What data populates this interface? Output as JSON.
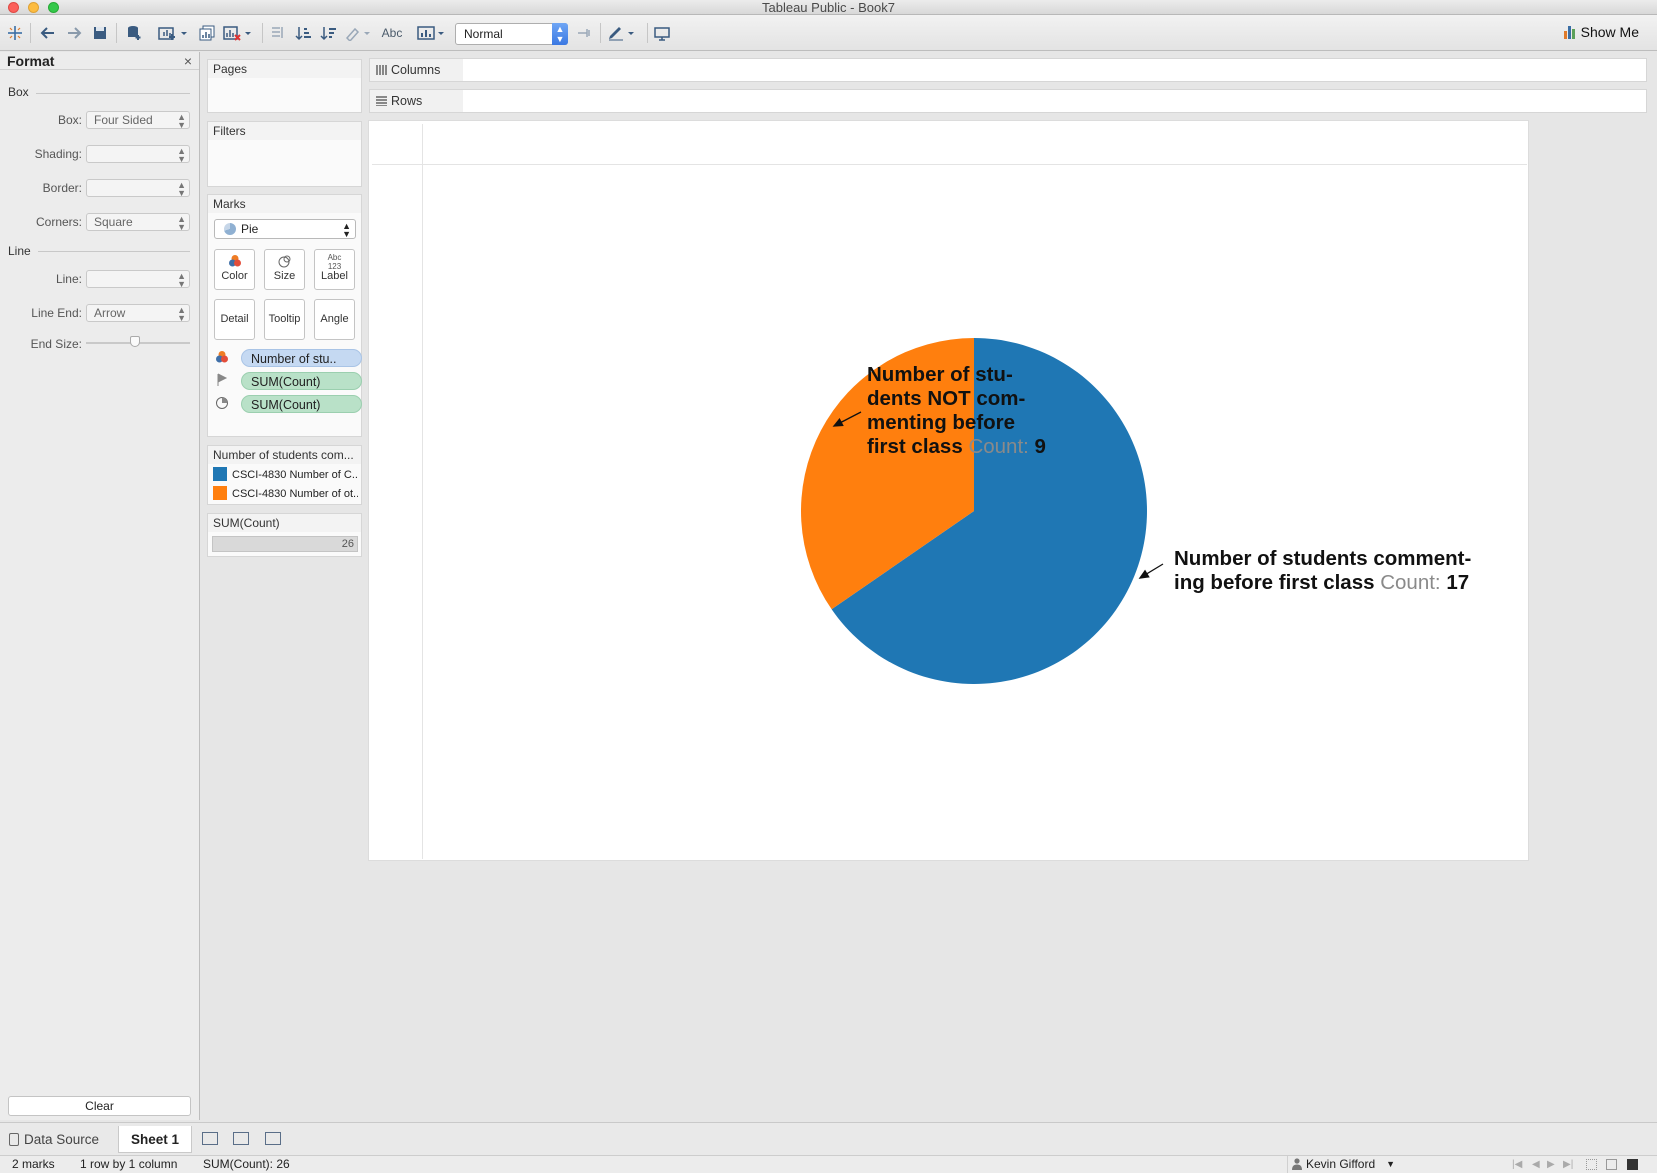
{
  "window": {
    "title": "Tableau Public - Book7"
  },
  "toolbar": {
    "fit_value": "Normal",
    "show_me_label": "Show Me",
    "abc_label": "Abc"
  },
  "format_pane": {
    "title": "Format",
    "close_glyph": "×",
    "box_section": "Box",
    "line_section": "Line",
    "rows": [
      {
        "label": "Box:",
        "value": "Four Sided"
      },
      {
        "label": "Shading:",
        "value": ""
      },
      {
        "label": "Border:",
        "value": ""
      },
      {
        "label": "Corners:",
        "value": "Square"
      },
      {
        "label": "Line:",
        "value": ""
      },
      {
        "label": "Line End:",
        "value": "Arrow"
      },
      {
        "label": "End Size:",
        "value": ""
      }
    ],
    "clear_label": "Clear"
  },
  "shelves": {
    "pages": "Pages",
    "filters": "Filters",
    "marks": "Marks",
    "columns": "Columns",
    "rows": "Rows"
  },
  "marks": {
    "type": "Pie",
    "buttons": {
      "color": "Color",
      "size": "Size",
      "label": "Label",
      "label_icon": "Abc\n123",
      "detail": "Detail",
      "tooltip": "Tooltip",
      "angle": "Angle"
    },
    "pills": [
      {
        "icon": "color-icon",
        "text": "Number of stu..",
        "kind": "dimension"
      },
      {
        "icon": "label-icon",
        "text": "SUM(Count)",
        "kind": "measure"
      },
      {
        "icon": "angle-icon",
        "text": "SUM(Count)",
        "kind": "measure"
      }
    ]
  },
  "color_legend": {
    "title": "Number of students com...",
    "items": [
      {
        "text": "CSCI-4830 Number of C...",
        "color": "#1f77b4"
      },
      {
        "text": "CSCI-4830 Number of ot...",
        "color": "#ff7f0e"
      }
    ]
  },
  "size_legend": {
    "title": "SUM(Count)",
    "value": "26"
  },
  "chart_data": {
    "type": "pie",
    "slices": [
      {
        "name": "Number of students commenting before first class",
        "value": 17,
        "color": "#1f77b4"
      },
      {
        "name": "Number of students NOT commenting before first class",
        "value": 9,
        "color": "#ff7f0e"
      }
    ],
    "total": 26,
    "annotations": [
      {
        "lines": [
          "Number of stu-",
          "dents NOT com-",
          "menting before",
          "first class"
        ],
        "count_label": "Count:",
        "count_value": "9"
      },
      {
        "lines": [
          "Number of students comment-",
          "ing before first class"
        ],
        "count_label": "Count:",
        "count_value": "17"
      }
    ]
  },
  "tabs": {
    "data_source": "Data Source",
    "sheet": "Sheet 1"
  },
  "status": {
    "marks": "2 marks",
    "dims": "1 row by 1 column",
    "sum": "SUM(Count): 26",
    "user": "Kevin Gifford"
  }
}
